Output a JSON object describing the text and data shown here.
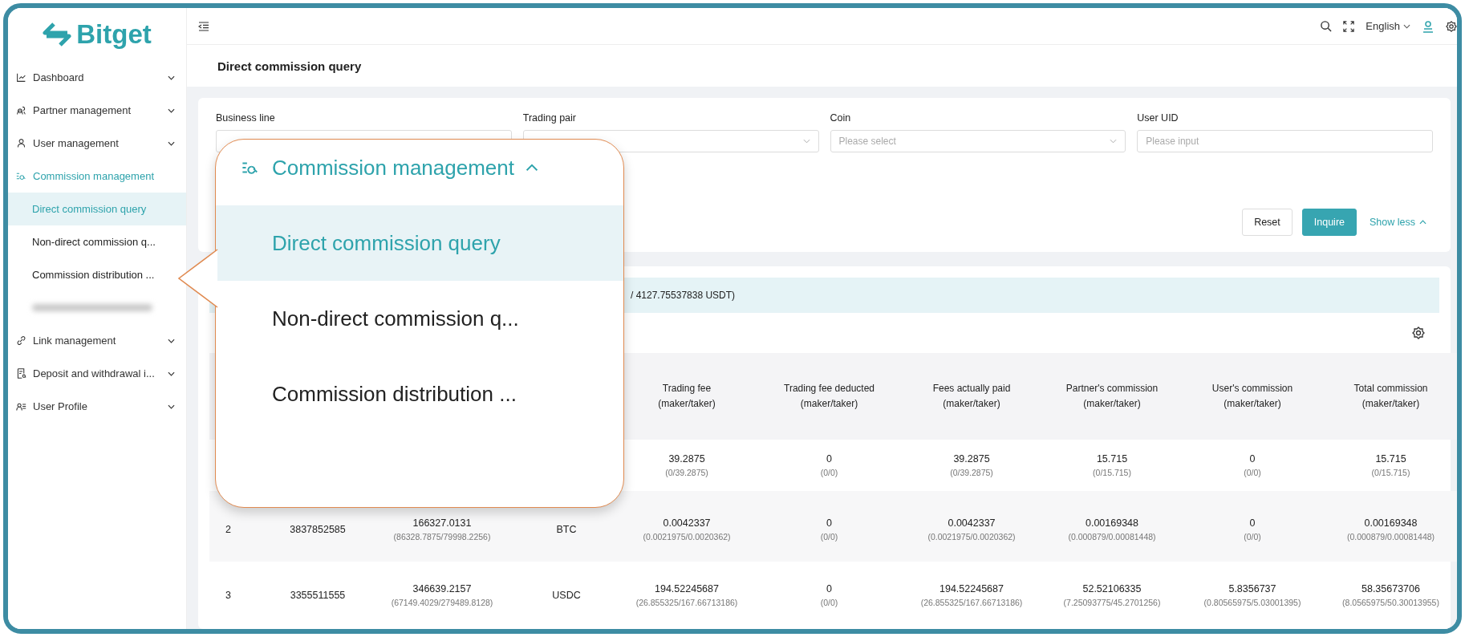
{
  "logo": "Bitget",
  "sidebar": {
    "items": [
      {
        "label": "Dashboard",
        "expanded": false
      },
      {
        "label": "Partner management",
        "expanded": false
      },
      {
        "label": "User management",
        "expanded": false
      },
      {
        "label": "Commission management",
        "expanded": true,
        "children": [
          {
            "kind": "link",
            "label": "Direct commission query",
            "selected": true
          },
          {
            "kind": "link",
            "label": "Non-direct commission q...",
            "selected": false
          },
          {
            "kind": "link",
            "label": "Commission distribution ...",
            "selected": false
          },
          {
            "kind": "redacted",
            "selected": false
          }
        ]
      },
      {
        "label": "Link management",
        "expanded": false
      },
      {
        "label": "Deposit and withdrawal i...",
        "expanded": false
      },
      {
        "label": "User Profile",
        "expanded": false
      }
    ]
  },
  "header": {
    "language": "English"
  },
  "page_title": "Direct commission query",
  "filters": [
    {
      "label": "Business line"
    },
    {
      "label": "Trading pair"
    },
    {
      "label": "Coin",
      "placeholder": "Please select"
    },
    {
      "label": "User UID",
      "placeholder": "Please input"
    }
  ],
  "buttons": {
    "reset": "Reset",
    "inquire": "Inquire",
    "toggle": "Show less"
  },
  "summary": "/ 4127.75537838 USDT)",
  "table": {
    "columns": [
      {
        "title": "Trading fee",
        "sub": "(maker/taker)"
      },
      {
        "title": "Trading fee deducted",
        "sub": "(maker/taker)"
      },
      {
        "title": "Fees actually paid",
        "sub": "(maker/taker)"
      },
      {
        "title": "Partner's commission",
        "sub": "(maker/taker)"
      },
      {
        "title": "User's commission",
        "sub": "(maker/taker)"
      },
      {
        "title": "Total commission",
        "sub": "(maker/taker)"
      }
    ],
    "rows": [
      {
        "cells": [
          {
            "main": "39.2875",
            "sub": "(0/39.2875)"
          },
          {
            "main": "0",
            "sub": "(0/0)"
          },
          {
            "main": "39.2875",
            "sub": "(0/39.2875)"
          },
          {
            "main": "15.715",
            "sub": "(0/15.715)"
          },
          {
            "main": "0",
            "sub": "(0/0)"
          },
          {
            "main": "15.715",
            "sub": "(0/15.715)"
          }
        ]
      },
      {
        "no": "2",
        "uid": "3837852585",
        "volume": {
          "main": "166327.0131",
          "sub": "(86328.7875/79998.2256)"
        },
        "coin": "BTC",
        "cells": [
          {
            "main": "0.0042337",
            "sub": "(0.0021975/0.0020362)"
          },
          {
            "main": "0",
            "sub": "(0/0)"
          },
          {
            "main": "0.0042337",
            "sub": "(0.0021975/0.0020362)"
          },
          {
            "main": "0.00169348",
            "sub": "(0.000879/0.00081448)"
          },
          {
            "main": "0",
            "sub": "(0/0)"
          },
          {
            "main": "0.00169348",
            "sub": "(0.000879/0.00081448)"
          }
        ]
      },
      {
        "no": "3",
        "uid": "3355511555",
        "volume": {
          "main": "346639.2157",
          "sub": "(67149.4029/279489.8128)"
        },
        "coin": "USDC",
        "cells": [
          {
            "main": "194.52245687",
            "sub": "(26.855325/167.66713186)"
          },
          {
            "main": "0",
            "sub": "(0/0)"
          },
          {
            "main": "194.52245687",
            "sub": "(26.855325/167.66713186)"
          },
          {
            "main": "52.52106335",
            "sub": "(7.25093775/45.2701256)"
          },
          {
            "main": "5.8356737",
            "sub": "(0.80565975/5.03001395)"
          },
          {
            "main": "58.35673706",
            "sub": "(8.0565975/50.30013955)"
          }
        ]
      }
    ]
  },
  "callout": {
    "title": "Commission management",
    "expanded": true,
    "items": [
      {
        "label": "Direct commission query",
        "selected": true
      },
      {
        "label": "Non-direct commission q...",
        "selected": false
      },
      {
        "label": "Commission distribution ...",
        "selected": false
      }
    ]
  }
}
